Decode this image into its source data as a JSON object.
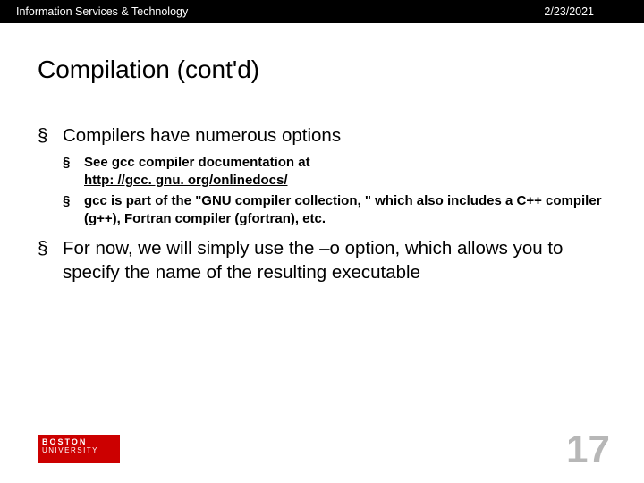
{
  "header": {
    "org": "Information Services & Technology",
    "date": "2/23/2021"
  },
  "title": "Compilation (cont'd)",
  "bullets": {
    "b1": "Compilers have numerous options",
    "b2a_pre": "See gcc compiler documentation at ",
    "b2a_link": "http: //gcc. gnu. org/onlinedocs/",
    "b2b": "gcc is part of the \"GNU compiler collection, \" which also includes a C++ compiler (g++), Fortran compiler (gfortran), etc.",
    "b3": "For now, we will simply use the –o option, which allows you to specify the name of the resulting executable"
  },
  "footer": {
    "logo_top": "BOSTON",
    "logo_bot": "UNIVERSITY",
    "page": "17"
  },
  "marker": "§"
}
